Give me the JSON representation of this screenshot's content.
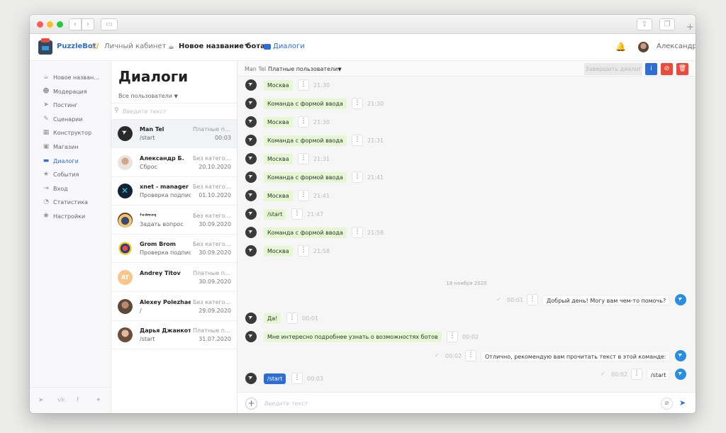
{
  "header": {
    "brand": "PuzzleBot",
    "brand_mark": "://",
    "cabinet": "Личный кабинет",
    "separator": "/",
    "bot_name": "Новое название бота",
    "dialogs_link": "Диалоги",
    "user_name": "Александр"
  },
  "sidebar": {
    "items": [
      {
        "label": "Новое назван...",
        "icon": "bot-icon"
      },
      {
        "label": "Модерация",
        "icon": "users-icon"
      },
      {
        "label": "Постинг",
        "icon": "send-icon"
      },
      {
        "label": "Сценарии",
        "icon": "chat-icon"
      },
      {
        "label": "Конструктор",
        "icon": "grid-icon"
      },
      {
        "label": "Магазин",
        "icon": "shop-icon"
      },
      {
        "label": "Диалоги",
        "icon": "dialogs-icon"
      },
      {
        "label": "События",
        "icon": "star-icon"
      },
      {
        "label": "Вход",
        "icon": "login-icon"
      },
      {
        "label": "Статистика",
        "icon": "pie-icon"
      },
      {
        "label": "Настройки",
        "icon": "gear-icon"
      }
    ],
    "social": [
      "telegram-icon",
      "vk-icon",
      "facebook-icon",
      "twitter-icon"
    ]
  },
  "list": {
    "title": "Диалоги",
    "filter": "Все пользователи",
    "search_placeholder": "Введите текст",
    "dialogs": [
      {
        "name": "Man Tel",
        "category": "Платные п...",
        "last": "/start",
        "date": "00:03",
        "avatar": "telegram"
      },
      {
        "name": "Александр Б.",
        "category": "Без катего...",
        "last": "Сброс",
        "date": "20.10.2020",
        "avatar": "photo1"
      },
      {
        "name": "xnet - manager",
        "category": "Без катего...",
        "last": "Проверка подписки",
        "date": "01.10.2020",
        "avatar": "xnet"
      },
      {
        "name": "ᶠᵉᵈᵐᵒᵑ",
        "category": "Без катего...",
        "last": "Задать вопрос",
        "date": "30.09.2020",
        "avatar": "admin"
      },
      {
        "name": "Grom Brom",
        "category": "Без катего...",
        "last": "Проверка подписки",
        "date": "30.09.2020",
        "avatar": "grom"
      },
      {
        "name": "Andrey Titov",
        "category": "Платные п...",
        "last": "",
        "date": "30.09.2020",
        "avatar": "initials",
        "initials": "AT"
      },
      {
        "name": "Alexey Polezhaev",
        "category": "Без катего...",
        "last": "/",
        "date": "29.09.2020",
        "avatar": "photo2"
      },
      {
        "name": "Дарья Джанкотти",
        "category": "Платные п...",
        "last": "/start",
        "date": "31.07.2020",
        "avatar": "photo3"
      }
    ]
  },
  "chat": {
    "user": "Man Tel",
    "filter": "Платные пользователи",
    "finish_button": "Завершить диалог",
    "info_label": "i",
    "block_label": "⊘",
    "delete_label": "🗑",
    "date_separator": "18 ноября 2020",
    "menu_label": "⋮",
    "check_label": "✓",
    "messages": [
      {
        "dir": "in",
        "type": "text",
        "text": "Москва",
        "time": "21:30"
      },
      {
        "dir": "in",
        "type": "text",
        "text": "Команда с формой ввода",
        "time": "21:30"
      },
      {
        "dir": "in",
        "type": "text",
        "text": "Москва",
        "time": "21:30"
      },
      {
        "dir": "in",
        "type": "text",
        "text": "Команда с формой ввода",
        "time": "21:31"
      },
      {
        "dir": "in",
        "type": "text",
        "text": "Москва",
        "time": "21:31"
      },
      {
        "dir": "in",
        "type": "text",
        "text": "Команда с формой ввода",
        "time": "21:41"
      },
      {
        "dir": "in",
        "type": "text",
        "text": "Москва",
        "time": "21:41"
      },
      {
        "dir": "in",
        "type": "text",
        "text": "/start",
        "time": "21:47"
      },
      {
        "dir": "in",
        "type": "text",
        "text": "Команда с формой ввода",
        "time": "21:58"
      },
      {
        "dir": "in",
        "type": "text",
        "text": "Москва",
        "time": "21:58"
      },
      {
        "dir": "out",
        "type": "text",
        "text": "Добрый день! Могу вам чем-то помочь?",
        "time": "00:01"
      },
      {
        "dir": "in",
        "type": "text",
        "text": "Да!",
        "time": "00:01"
      },
      {
        "dir": "in",
        "type": "text",
        "text": "Мне интересно подробнее узнать о возможностях ботов",
        "time": "00:02"
      },
      {
        "dir": "out",
        "type": "text",
        "text": "Отлично, рекомендую вам прочитать текст в этой команде:",
        "time": "00:02"
      },
      {
        "dir": "out",
        "type": "text",
        "text": "/start",
        "time": "00:02"
      },
      {
        "dir": "in",
        "type": "command",
        "text": "/start",
        "time": "00:03"
      }
    ],
    "input_placeholder": "Введите текст",
    "add_label": "+",
    "attach_label": "⌀",
    "send_label": "➤"
  },
  "colors": {
    "accent": "#2c6dd6",
    "danger": "#e74c3c",
    "incoming_bubble": "#e5f7d3",
    "command_bubble": "#2c6dd6"
  }
}
